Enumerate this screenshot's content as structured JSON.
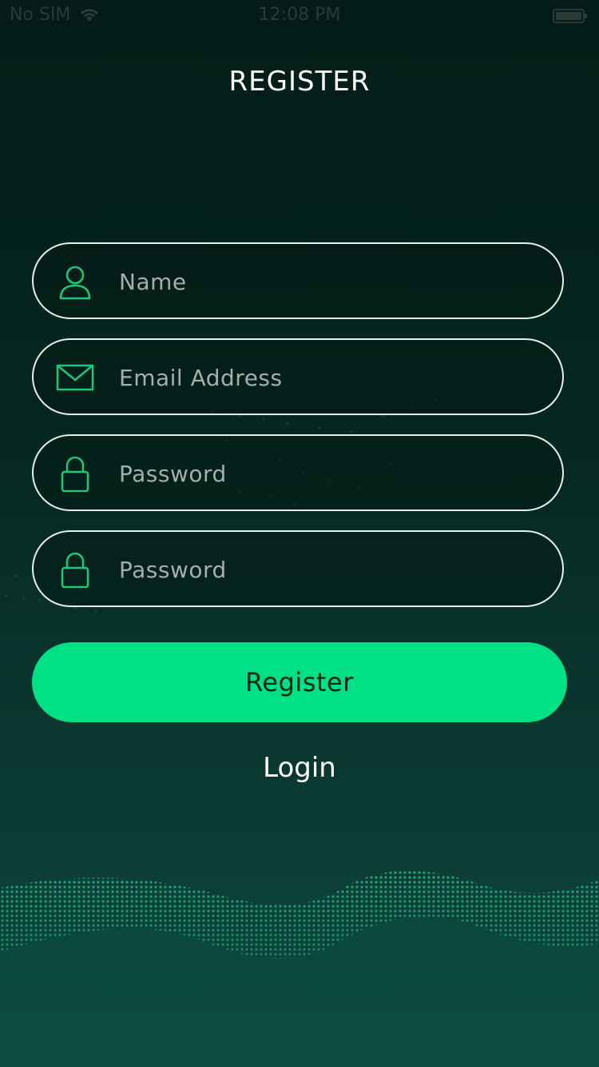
{
  "status_bar": {
    "carrier": "No SIM",
    "time": "12:08 PM"
  },
  "page": {
    "title": "REGISTER"
  },
  "form": {
    "name_placeholder": "Name",
    "email_placeholder": "Email Address",
    "password_placeholder": "Password",
    "confirm_password_placeholder": "Password",
    "register_label": "Register",
    "login_label": "Login"
  },
  "icons": {
    "name": "user-icon",
    "email": "envelope-icon",
    "password": "lock-icon",
    "confirm_password": "lock-icon"
  },
  "colors": {
    "accent": "#00e084",
    "icon_green": "#1fc77a",
    "background_top": "#041c17",
    "background_bottom": "#0d4a40"
  }
}
